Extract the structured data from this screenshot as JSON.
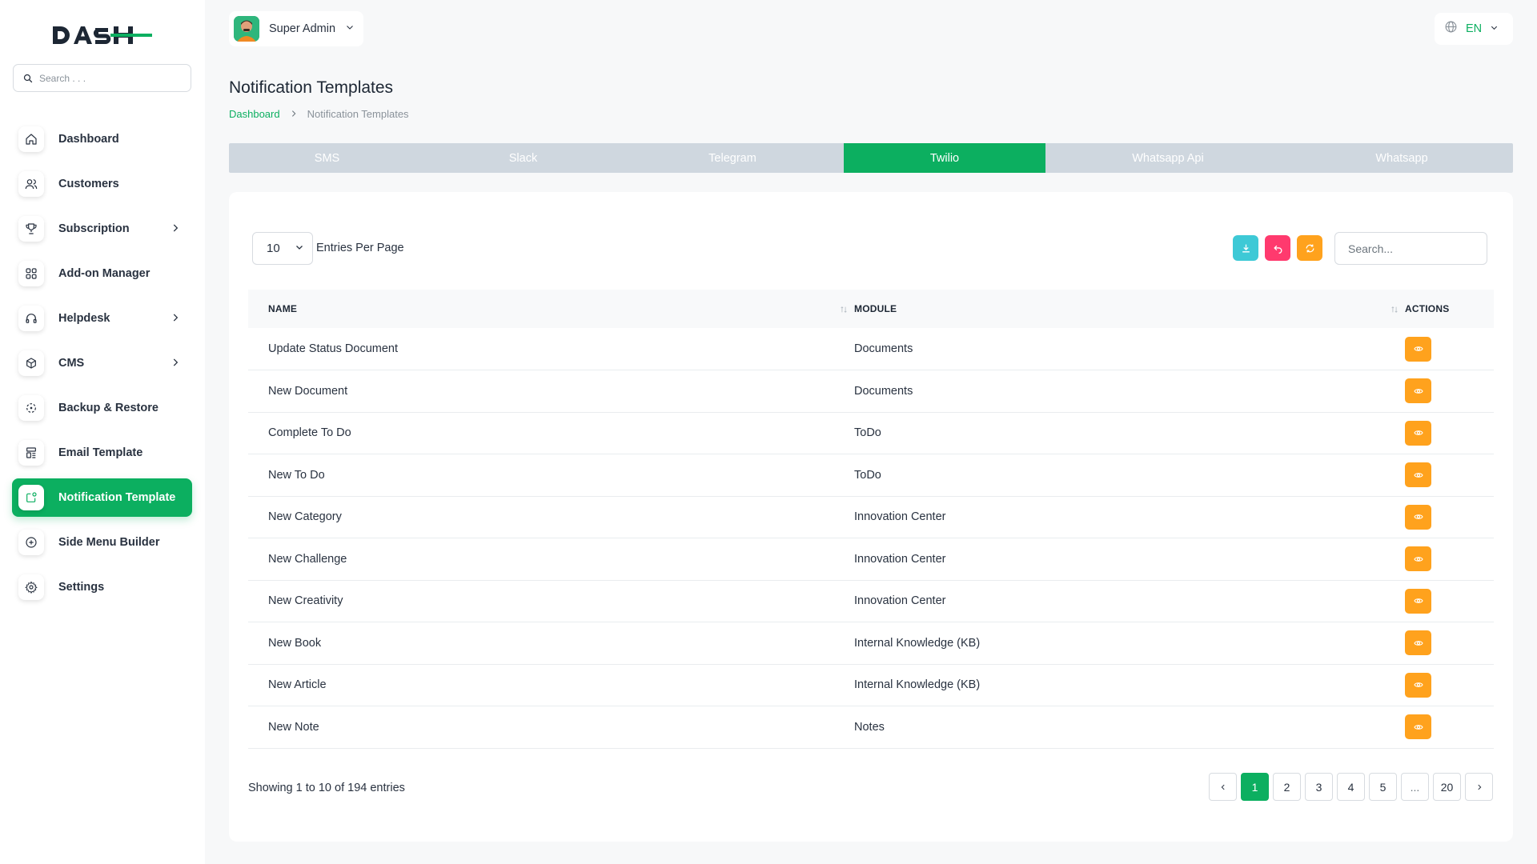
{
  "brand": {
    "logo_text": "DASH",
    "accent": "#0caf60"
  },
  "sidebar": {
    "search_placeholder": "Search . . .",
    "items": [
      {
        "label": "Dashboard",
        "icon": "home-icon",
        "has_arrow": false
      },
      {
        "label": "Customers",
        "icon": "users-icon",
        "has_arrow": false
      },
      {
        "label": "Subscription",
        "icon": "trophy-icon",
        "has_arrow": true
      },
      {
        "label": "Add-on Manager",
        "icon": "grid-icon",
        "has_arrow": false
      },
      {
        "label": "Helpdesk",
        "icon": "headphones-icon",
        "has_arrow": true
      },
      {
        "label": "CMS",
        "icon": "package-icon",
        "has_arrow": true
      },
      {
        "label": "Backup & Restore",
        "icon": "backup-icon",
        "has_arrow": false
      },
      {
        "label": "Email Template",
        "icon": "template-icon",
        "has_arrow": false
      },
      {
        "label": "Notification Template",
        "icon": "notification-icon",
        "has_arrow": false,
        "active": true
      },
      {
        "label": "Side Menu Builder",
        "icon": "plus-circle-icon",
        "has_arrow": false
      },
      {
        "label": "Settings",
        "icon": "gear-icon",
        "has_arrow": false
      }
    ]
  },
  "header": {
    "user_name": "Super Admin",
    "language": "EN"
  },
  "page": {
    "title": "Notification Templates",
    "breadcrumb": {
      "home": "Dashboard",
      "current": "Notification Templates"
    }
  },
  "tabs": [
    {
      "label": "SMS",
      "active": false
    },
    {
      "label": "Slack",
      "active": false
    },
    {
      "label": "Telegram",
      "active": false
    },
    {
      "label": "Twilio",
      "active": true
    },
    {
      "label": "Whatsapp Api",
      "active": false
    },
    {
      "label": "Whatsapp",
      "active": false
    }
  ],
  "table": {
    "per_page": "10",
    "per_page_label": "Entries Per Page",
    "search_placeholder": "Search...",
    "columns": {
      "name": "NAME",
      "module": "MODULE",
      "actions": "ACTIONS"
    },
    "rows": [
      {
        "name": "Update Status Document",
        "module": "Documents"
      },
      {
        "name": "New Document",
        "module": "Documents"
      },
      {
        "name": "Complete To Do",
        "module": "ToDo"
      },
      {
        "name": "New To Do",
        "module": "ToDo"
      },
      {
        "name": "New Category",
        "module": "Innovation Center"
      },
      {
        "name": "New Challenge",
        "module": "Innovation Center"
      },
      {
        "name": "New Creativity",
        "module": "Innovation Center"
      },
      {
        "name": "New Book",
        "module": "Internal Knowledge (KB)"
      },
      {
        "name": "New Article",
        "module": "Internal Knowledge (KB)"
      },
      {
        "name": "New Note",
        "module": "Notes"
      }
    ],
    "showing": "Showing 1 to 10 of 194 entries",
    "pages": [
      "1",
      "2",
      "3",
      "4",
      "5",
      "...",
      "20"
    ],
    "current_page": "1"
  },
  "colors": {
    "download": "#3ec9d6",
    "undo": "#ff3a6e",
    "refresh": "#ffa21d",
    "view": "#ffa21d"
  }
}
